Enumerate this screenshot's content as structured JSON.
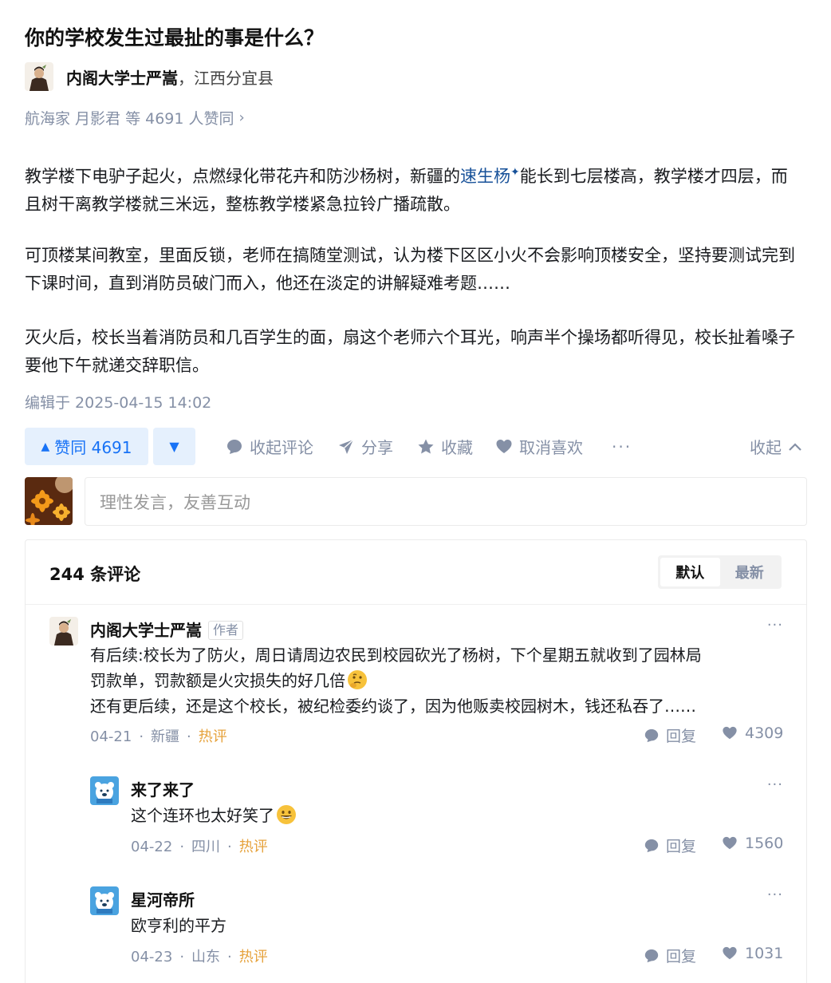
{
  "question": {
    "title": "你的学校发生过最扯的事是什么？"
  },
  "answer": {
    "author_name": "内阁大学士严嵩",
    "author_location": "，江西分宜县",
    "voters_text": "航海家 月影君 等 4691 人赞同",
    "p1_before": "教学楼下电驴子起火，点燃绿化带花卉和防沙杨树，新疆的",
    "p1_link": "速生杨",
    "p1_after": "能长到七层楼高，教学楼才四层，而且树干离教学楼就三米远，整栋教学楼紧急拉铃广播疏散。",
    "p2": "可顶楼某间教室，里面反锁，老师在搞随堂测试，认为楼下区区小火不会影响顶楼安全，坚持要测试完到下课时间，直到消防员破门而入，他还在淡定的讲解疑难考题……",
    "p3": "灭火后，校长当着消防员和几百学生的面，扇这个老师六个耳光，响声半个操场都听得见，校长扯着嗓子要他下午就递交辞职信。",
    "edited": "编辑于 2025-04-15 14:02"
  },
  "actions": {
    "vote_up": "赞同 4691",
    "comment": "收起评论",
    "share": "分享",
    "favorite": "收藏",
    "like": "取消喜欢",
    "more": "···",
    "collapse": "收起"
  },
  "composer": {
    "placeholder": "理性发言，友善互动"
  },
  "comments": {
    "count": "244 条评论",
    "sort_default": "默认",
    "sort_latest": "最新",
    "items": [
      {
        "name": "内阁大学士严嵩",
        "badge": "作者",
        "line1": "有后续:校长为了防火，周日请周边农民到校园砍光了杨树，下个星期五就收到了园林局",
        "line2": "罚款单，罚款额是火灾损失的好几倍",
        "line3": "还有更后续，还是这个校长，被纪检委约谈了，因为他贩卖校园树木，钱还私吞了……",
        "date": "04-21",
        "region": "新疆",
        "hot": "热评",
        "reply": "回复",
        "likes": "4309"
      },
      {
        "name": "来了来了",
        "text": "这个连环也太好笑了",
        "date": "04-22",
        "region": "四川",
        "hot": "热评",
        "reply": "回复",
        "likes": "1560"
      },
      {
        "name": "星河帝所",
        "text": "欧亨利的平方",
        "date": "04-23",
        "region": "山东",
        "hot": "热评",
        "reply": "回复",
        "likes": "1031"
      }
    ]
  },
  "colors": {
    "brand_blue": "#1772f6",
    "vote_bg": "#e5f0fd",
    "muted": "#8590a6",
    "hot": "#e6a23c",
    "link": "#175199"
  },
  "icons": [
    "author-avatar",
    "chevron-right-icon",
    "sparkle-icon",
    "triangle-up-icon",
    "triangle-down-icon",
    "comment-bubble-icon",
    "paper-plane-icon",
    "star-icon",
    "heart-icon",
    "chevron-up-icon",
    "flower-avatar",
    "bear-avatar",
    "thinking-emoji",
    "grin-emoji"
  ]
}
